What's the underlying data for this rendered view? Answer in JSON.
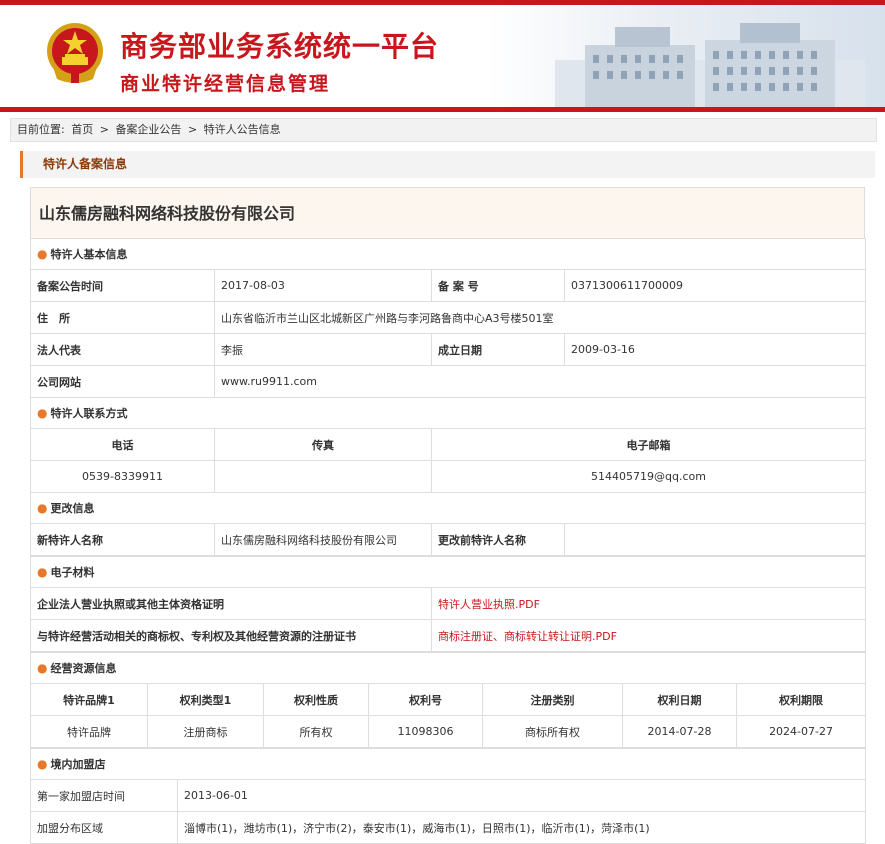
{
  "header": {
    "title": "商务部业务系统统一平台",
    "subtitle": "商业特许经营信息管理"
  },
  "breadcrumb": {
    "prefix": "目前位置:",
    "home": "首页",
    "sep1": ">",
    "level1": "备案企业公告",
    "sep2": ">",
    "current": "特许人公告信息"
  },
  "section_title": "特许人备案信息",
  "company_name": "山东儒房融科网络科技股份有限公司",
  "basic": {
    "title": "特许人基本信息",
    "filing_time_label": "备案公告时间",
    "filing_time": "2017-08-03",
    "filing_no_label": "备 案 号",
    "filing_no": "0371300611700009",
    "address_label": "住　所",
    "address": "山东省临沂市兰山区北城新区广州路与李河路鲁商中心A3号楼501室",
    "legal_rep_label": "法人代表",
    "legal_rep": "李振",
    "founded_label": "成立日期",
    "founded": "2009-03-16",
    "website_label": "公司网站",
    "website": "www.ru9911.com"
  },
  "contact": {
    "title": "特许人联系方式",
    "phone_label": "电话",
    "fax_label": "传真",
    "email_label": "电子邮箱",
    "phone": "0539-8339911",
    "fax": "",
    "email": "514405719@qq.com"
  },
  "change": {
    "title": "更改信息",
    "new_name_label": "新特许人名称",
    "new_name": "山东儒房融科网络科技股份有限公司",
    "old_name_label": "更改前特许人名称",
    "old_name": ""
  },
  "materials": {
    "title": "电子材料",
    "row1_label": "企业法人营业执照或其他主体资格证明",
    "row1_link": "特许人营业执照.PDF",
    "row2_label": "与特许经营活动相关的商标权、专利权及其他经营资源的注册证书",
    "row2_link": "商标注册证、商标转让转让证明.PDF"
  },
  "resources": {
    "title": "经营资源信息",
    "headers": [
      "特许品牌1",
      "权利类型1",
      "权利性质",
      "权利号",
      "注册类别",
      "权利日期",
      "权利期限"
    ],
    "row": [
      "特许品牌",
      "注册商标",
      "所有权",
      "11098306",
      "商标所有权",
      "2014-07-28",
      "2024-07-27"
    ]
  },
  "stores": {
    "title": "境内加盟店",
    "first_label": "第一家加盟店时间",
    "first": "2013-06-01",
    "region_label": "加盟分布区域",
    "region": "淄博市(1)，潍坊市(1)，济宁市(2)，泰安市(1)，威海市(1)，日照市(1)，临沂市(1)，菏泽市(1)"
  },
  "colors": {
    "accent": "#c8161d",
    "orange": "#e8782a"
  }
}
